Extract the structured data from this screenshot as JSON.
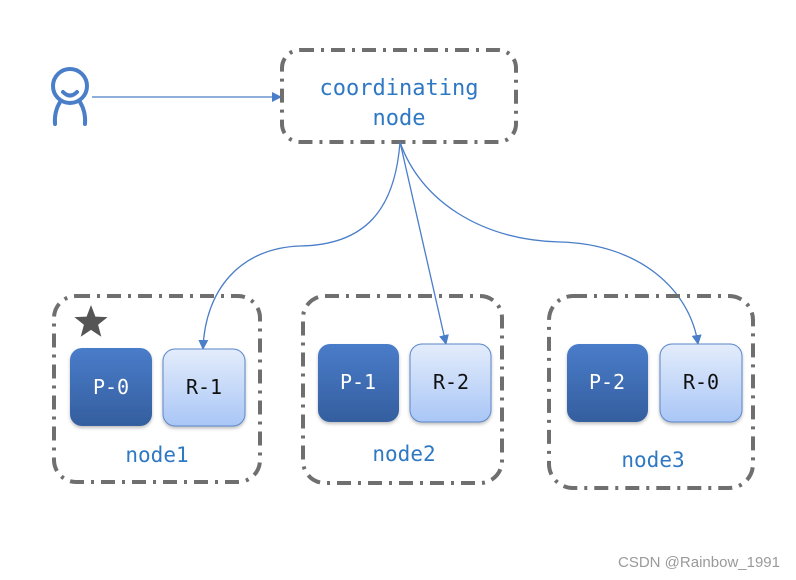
{
  "coordinating_node": {
    "line1": "coordinating",
    "line2": "node"
  },
  "nodes": [
    {
      "label": "node1",
      "primary": "P-0",
      "replica": "R-1",
      "is_master": true
    },
    {
      "label": "node2",
      "primary": "P-1",
      "replica": "R-2",
      "is_master": false
    },
    {
      "label": "node3",
      "primary": "P-2",
      "replica": "R-0",
      "is_master": false
    }
  ],
  "icons": {
    "client": "person-icon",
    "master": "star-icon"
  },
  "colors": {
    "accent": "#4a7ec8",
    "text_blue": "#2f78c4",
    "dash_gray": "#6f6f6f",
    "primary_top": "#4a7cc9",
    "primary_bottom": "#345e9e",
    "replica_top": "#e3ecfb",
    "replica_bottom": "#a9c6f6",
    "star": "#555555"
  },
  "watermark": "CSDN @Rainbow_1991"
}
